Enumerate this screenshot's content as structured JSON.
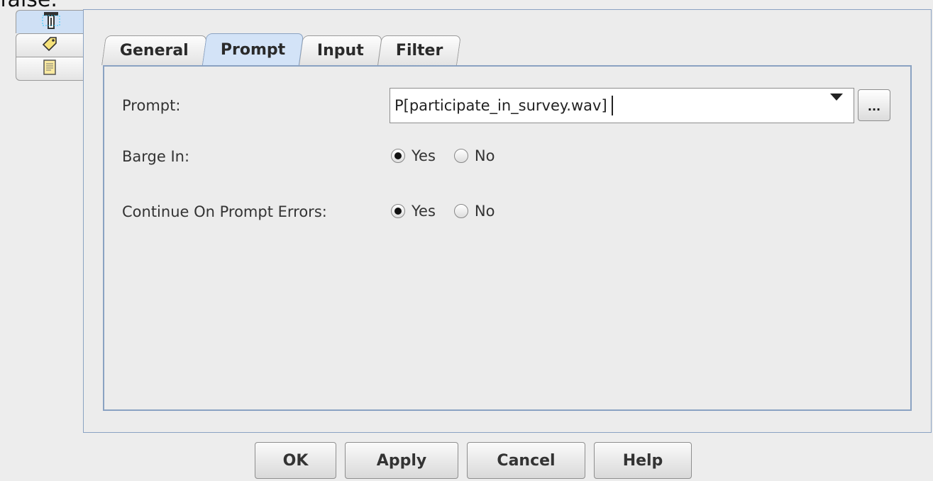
{
  "top_fragment": "false.",
  "side_tabs": [
    {
      "icon": "toolbar-icon",
      "active": true
    },
    {
      "icon": "tag-icon",
      "active": false
    },
    {
      "icon": "document-icon",
      "active": false
    }
  ],
  "tabs": [
    {
      "label": "General",
      "active": false
    },
    {
      "label": "Prompt",
      "active": true
    },
    {
      "label": "Input",
      "active": false
    },
    {
      "label": "Filter",
      "active": false
    }
  ],
  "form": {
    "prompt_label": "Prompt:",
    "prompt_value": "P[participate_in_survey.wav]",
    "browse_label": "...",
    "barge_label": "Barge In:",
    "barge_options": [
      "Yes",
      "No"
    ],
    "barge_selected": "Yes",
    "continue_label": "Continue On Prompt Errors:",
    "continue_options": [
      "Yes",
      "No"
    ],
    "continue_selected": "Yes"
  },
  "buttons": {
    "ok": "OK",
    "apply": "Apply",
    "cancel": "Cancel",
    "help": "Help"
  },
  "colors": {
    "accent_border": "#8aa2c2",
    "active_tab": "#d3e3f7"
  }
}
